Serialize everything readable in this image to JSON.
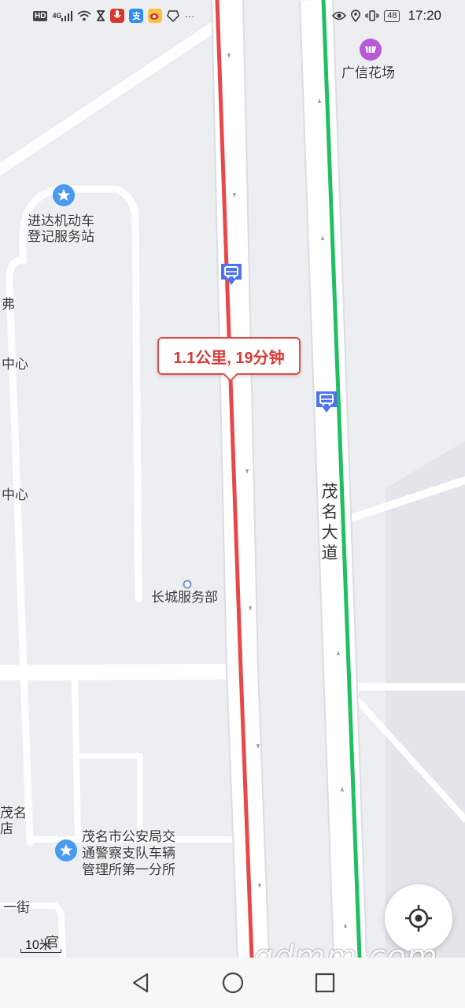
{
  "status_bar": {
    "hd": "HD",
    "network": "4G",
    "time": "17:20",
    "battery": "48",
    "more": "···"
  },
  "route": {
    "summary": "1.1公里, 19分钟"
  },
  "map_labels": {
    "poi_guangxin": "广信花场",
    "poi_jinda_line1": "进达机动车",
    "poi_jinda_line2": "登记服务站",
    "partial_fu": "弗",
    "partial_center1": "中心",
    "partial_center2": "中心",
    "poi_changcheng": "长城服务部",
    "poi_police_line1": "茂名市公安局交",
    "poi_police_line2": "通警察支队车辆",
    "poi_police_line3": "管理所第一分所",
    "partial_maoming_line1": "茂名",
    "partial_maoming_line2": "店",
    "partial_street": "一街",
    "partial_guan": "官",
    "road_name": "茂名大道"
  },
  "scale": {
    "label": "10米"
  },
  "watermark": "gdmm.com",
  "colors": {
    "route_red": "#e8484a",
    "route_green": "#1fbf62",
    "road_white": "#ffffff",
    "bus_blue": "#4d74f0",
    "poi_star_blue": "#4a9af0",
    "poi_shop_purple": "#b85ad6"
  },
  "icons": {
    "locate": "crosshair-icon",
    "back": "triangle-back-icon",
    "home": "circle-home-icon",
    "recent": "square-recent-icon"
  }
}
